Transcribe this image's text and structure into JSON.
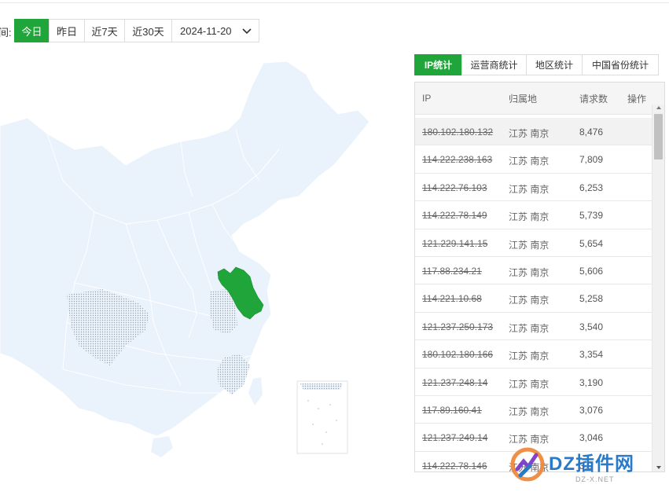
{
  "filter": {
    "label": "间:",
    "buttons": [
      "今日",
      "昨日",
      "近7天",
      "近30天"
    ],
    "active_index": 0,
    "date_value": "2024-11-20"
  },
  "tabs": [
    "IP统计",
    "运营商统计",
    "地区统计",
    "中国省份统计"
  ],
  "table": {
    "headers": {
      "ip": "IP",
      "location": "归属地",
      "requests": "请求数",
      "action": "操作"
    },
    "rows": [
      {
        "ip": "180.102.180.132",
        "location": "江苏 南京",
        "requests": "8,476"
      },
      {
        "ip": "114.222.238.163",
        "location": "江苏 南京",
        "requests": "7,809"
      },
      {
        "ip": "114.222.76.103",
        "location": "江苏 南京",
        "requests": "6,253"
      },
      {
        "ip": "114.222.78.149",
        "location": "江苏 南京",
        "requests": "5,739"
      },
      {
        "ip": "121.229.141.15",
        "location": "江苏 南京",
        "requests": "5,654"
      },
      {
        "ip": "117.88.234.21",
        "location": "江苏 南京",
        "requests": "5,606"
      },
      {
        "ip": "114.221.10.68",
        "location": "江苏 南京",
        "requests": "5,258"
      },
      {
        "ip": "121.237.250.173",
        "location": "江苏 南京",
        "requests": "3,540"
      },
      {
        "ip": "180.102.180.166",
        "location": "江苏 南京",
        "requests": "3,354"
      },
      {
        "ip": "121.237.248.14",
        "location": "江苏 南京",
        "requests": "3,190"
      },
      {
        "ip": "117.89.160.41",
        "location": "江苏 南京",
        "requests": "3,076"
      },
      {
        "ip": "121.237.249.14",
        "location": "江苏 南京",
        "requests": "3,046"
      },
      {
        "ip": "114.222.78.146",
        "location": "江苏 南京",
        "requests": "3,0"
      }
    ]
  },
  "map": {
    "highlight_province": "江苏",
    "base_color": "#eaf2fb",
    "highlight_color": "#20a53a"
  },
  "watermark": {
    "text": "DZ插件网",
    "sub": "DZ-X.NET"
  },
  "colors": {
    "accent": "#20a53a"
  }
}
